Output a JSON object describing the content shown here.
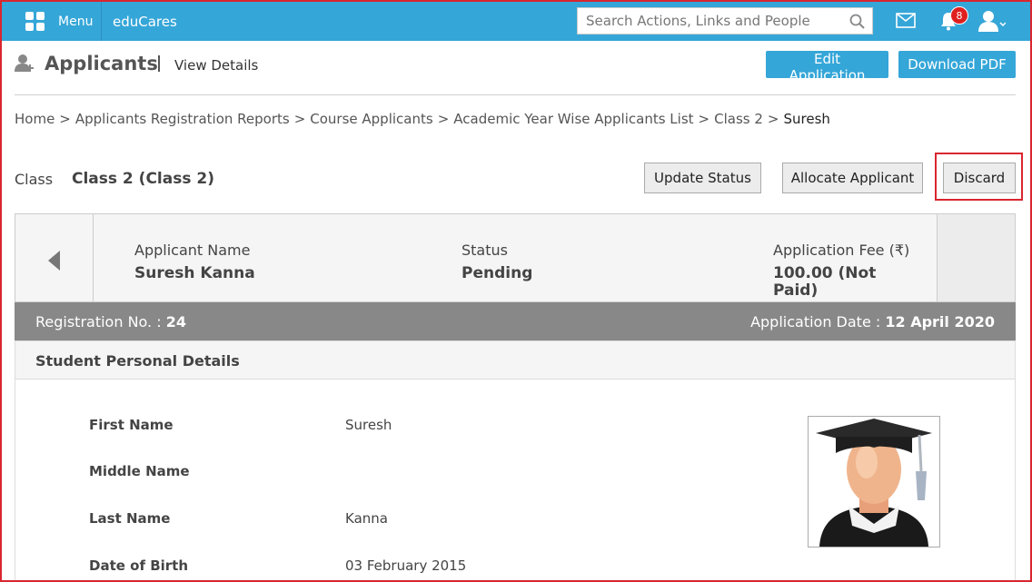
{
  "topbar": {
    "menu_label": "Menu",
    "brand": "eduCares",
    "search_placeholder": "Search Actions, Links and People",
    "notification_count": "8"
  },
  "header": {
    "title": "Applicants",
    "subtitle": "View Details",
    "edit_button": "Edit Application",
    "download_button": "Download PDF"
  },
  "breadcrumb": {
    "items": [
      "Home",
      "Applicants Registration Reports",
      "Course Applicants",
      "Academic Year Wise Applicants List",
      "Class 2"
    ],
    "separator": ">",
    "current": "Suresh"
  },
  "class_row": {
    "label": "Class",
    "value": "Class 2 (Class 2)",
    "update_status_button": "Update Status",
    "allocate_button": "Allocate Applicant",
    "discard_button": "Discard"
  },
  "summary": {
    "name_label": "Applicant Name",
    "name_value": "Suresh Kanna",
    "status_label": "Status",
    "status_value": "Pending",
    "fee_label": "Application Fee (₹)",
    "fee_value_line1": "100.00 (Not",
    "fee_value_line2": "Paid)"
  },
  "registration": {
    "reg_label": "Registration No. : ",
    "reg_value": "24",
    "date_label": "Application Date : ",
    "date_value": "12 April 2020"
  },
  "personal": {
    "section_title": "Student Personal Details",
    "fields": [
      {
        "label": "First Name",
        "value": "Suresh"
      },
      {
        "label": "Middle Name",
        "value": ""
      },
      {
        "label": "Last Name",
        "value": "Kanna"
      },
      {
        "label": "Date of Birth",
        "value": "03 February 2015"
      }
    ]
  },
  "colors": {
    "topbar": "#35a6d8",
    "highlight": "#d9262f",
    "reg_bar": "#888888"
  },
  "icons": [
    "grid-menu-icon",
    "search-icon",
    "mail-icon",
    "bell-icon",
    "user-icon",
    "applicant-icon",
    "chevron-left-icon",
    "graduate-avatar"
  ]
}
